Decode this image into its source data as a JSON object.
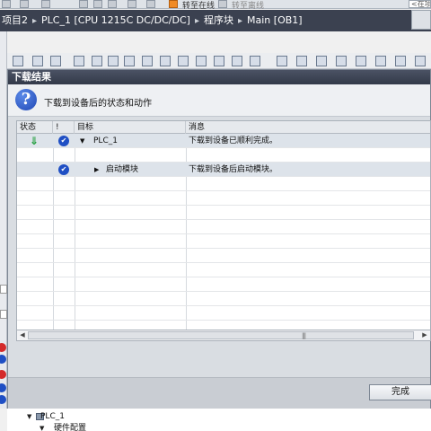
{
  "app_toolbar": {
    "go_online_label": "转至在线",
    "go_offline_label": "转至离线",
    "search_placeholder": "<在项"
  },
  "breadcrumb": {
    "items": [
      "项目2",
      "PLC_1 [CPU 1215C DC/DC/DC]",
      "程序块",
      "Main [OB1]"
    ],
    "separator": "▸"
  },
  "dialog": {
    "title": "下载结果",
    "subtitle": "下载到设备后的状态和动作",
    "columns": {
      "status": "状态",
      "flag": "!",
      "target": "目标",
      "message": "消息"
    },
    "rows": [
      {
        "target": "PLC_1",
        "message": "下载到设备已顺利完成。",
        "status_icon": "download-complete-icon",
        "flag_icon": "checkmark-icon"
      },
      {
        "target": "启动模块",
        "message": "下载到设备后启动模块。",
        "status_icon": "",
        "flag_icon": "checkmark-icon"
      }
    ],
    "scroll_grip": "|||",
    "finish_label": "完成"
  },
  "tree": {
    "items": [
      {
        "label": "PLC_1"
      },
      {
        "label": "硬件配置"
      }
    ]
  },
  "colors": {
    "title_bar": "#3b4150",
    "ok_icon": "#1f4fc4",
    "download_icon": "#1e9d3a",
    "error_icon": "#d42a2a"
  }
}
